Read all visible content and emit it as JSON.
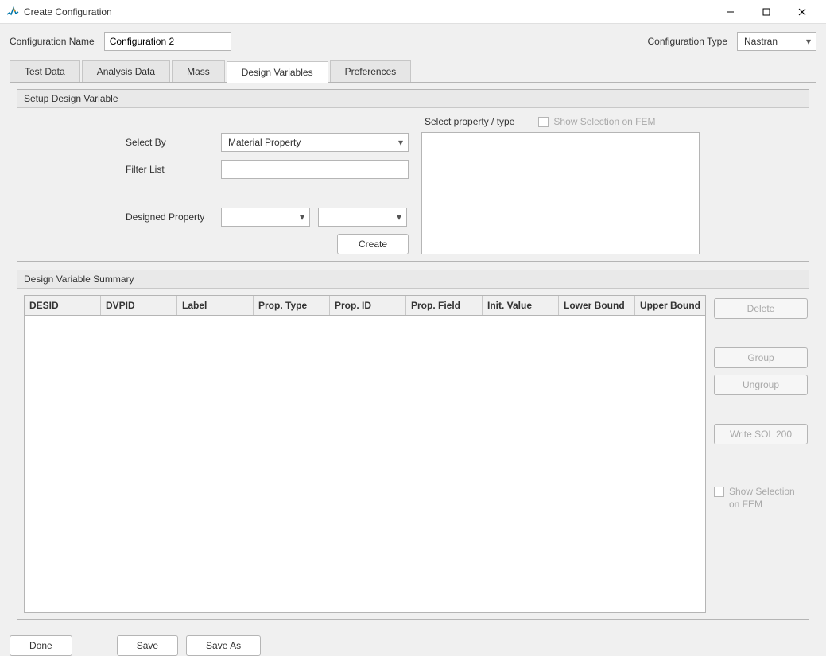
{
  "window": {
    "title": "Create Configuration"
  },
  "config_row": {
    "name_label": "Configuration Name",
    "name_value": "Configuration 2",
    "type_label": "Configuration Type",
    "type_value": "Nastran"
  },
  "tabs": {
    "test_data": "Test Data",
    "analysis_data": "Analysis Data",
    "mass": "Mass",
    "design_variables": "Design Variables",
    "preferences": "Preferences"
  },
  "setup": {
    "title": "Setup Design Variable",
    "select_by_label": "Select By",
    "select_by_value": "Material Property",
    "filter_label": "Filter List",
    "filter_value": "",
    "designed_property_label": "Designed Property",
    "designed_property_value1": "",
    "designed_property_value2": "",
    "create_btn": "Create",
    "select_property_label": "Select property / type",
    "show_selection_label": "Show Selection on FEM"
  },
  "summary": {
    "title": "Design Variable Summary",
    "columns": {
      "desid": "DESID",
      "dvpid": "DVPID",
      "label": "Label",
      "prop_type": "Prop. Type",
      "prop_id": "Prop. ID",
      "prop_field": "Prop. Field",
      "init_value": "Init. Value",
      "lower_bound": "Lower Bound",
      "upper_bound": "Upper Bound"
    },
    "side": {
      "delete": "Delete",
      "group": "Group",
      "ungroup": "Ungroup",
      "write_sol": "Write SOL 200",
      "show_selection": "Show Selection on FEM"
    }
  },
  "footer": {
    "done": "Done",
    "save": "Save",
    "save_as": "Save As"
  }
}
